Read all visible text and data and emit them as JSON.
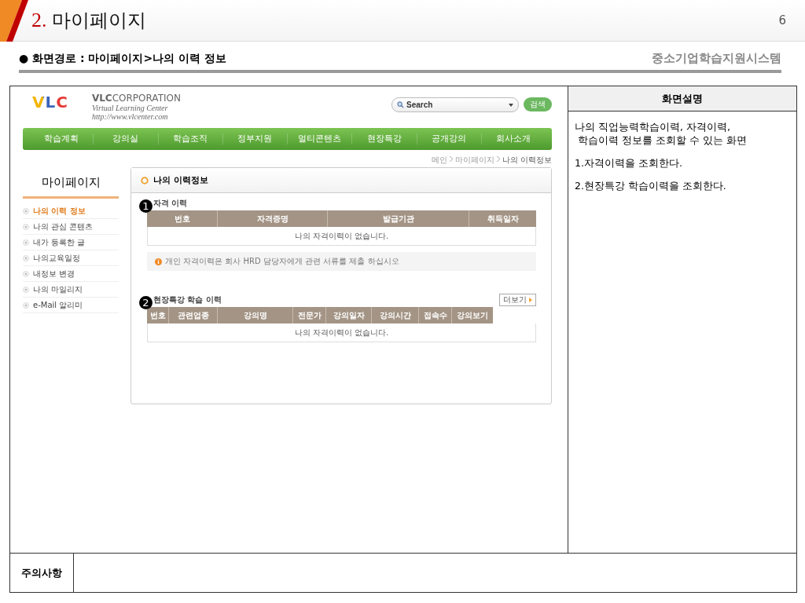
{
  "slide": {
    "number": "2.",
    "title": "마이페이지",
    "page": "6"
  },
  "path": "● 화면경로 : 마이페이지>나의 이력 정보",
  "system_name": "중소기업학습지원시스템",
  "mockup": {
    "logo": {
      "mark": "VLC",
      "company_bold": "VLC",
      "company": "CORPORATION",
      "tagline": "Virtual Learning Center",
      "url": "http://www.vlcenter.com"
    },
    "search": {
      "placeholder": "Search",
      "button": "검색"
    },
    "nav": [
      "학습계획",
      "강의실",
      "학습조직",
      "정부지원",
      "멀티콘텐츠",
      "현장특강",
      "공개강의",
      "회사소개"
    ],
    "breadcrumb": [
      {
        "label": "메인",
        "selected": false
      },
      {
        "label": "마이페이지",
        "selected": false
      },
      {
        "label": "나의 이력정보",
        "selected": true
      }
    ],
    "sidebar": {
      "title": "마이페이지",
      "items": [
        {
          "label": "나의 이력 정보",
          "selected": true
        },
        {
          "label": "나의 관심 콘텐츠",
          "selected": false
        },
        {
          "label": "내가 등록한 글",
          "selected": false
        },
        {
          "label": "나의교육일정",
          "selected": false
        },
        {
          "label": "내정보 변경",
          "selected": false
        },
        {
          "label": "나의 마일리지",
          "selected": false
        },
        {
          "label": "e-Mail 알리미",
          "selected": false
        }
      ]
    },
    "panel_title": "나의 이력정보",
    "sections": [
      {
        "marker": "1",
        "title": "자격 이력",
        "columns": [
          "번호",
          "자격증명",
          "발급기관",
          "취득일자"
        ],
        "empty": "나의 자격이력이 없습니다.",
        "notice": "개인 자격이력은 회사 HRD 담당자에게 관련 서류를 제출 하십시오"
      },
      {
        "marker": "2",
        "title": "현장특강 학습 이력",
        "more": "더보기",
        "columns": [
          "번호",
          "관련업종",
          "강의명",
          "전문가",
          "강의일자",
          "강의시간",
          "접속수",
          "강의보기"
        ],
        "empty": "나의 자격이력이 없습니다."
      }
    ]
  },
  "description": {
    "header": "화면설명",
    "paragraphs": [
      "나의 직업능력학습이력, 자격이력,\n 학습이력 정보를 조회할 수 있는 화면",
      "1.자격이력을 조회한다.",
      "2.현장특강 학습이력을 조회한다."
    ]
  },
  "notes": {
    "label": "주의사항"
  }
}
